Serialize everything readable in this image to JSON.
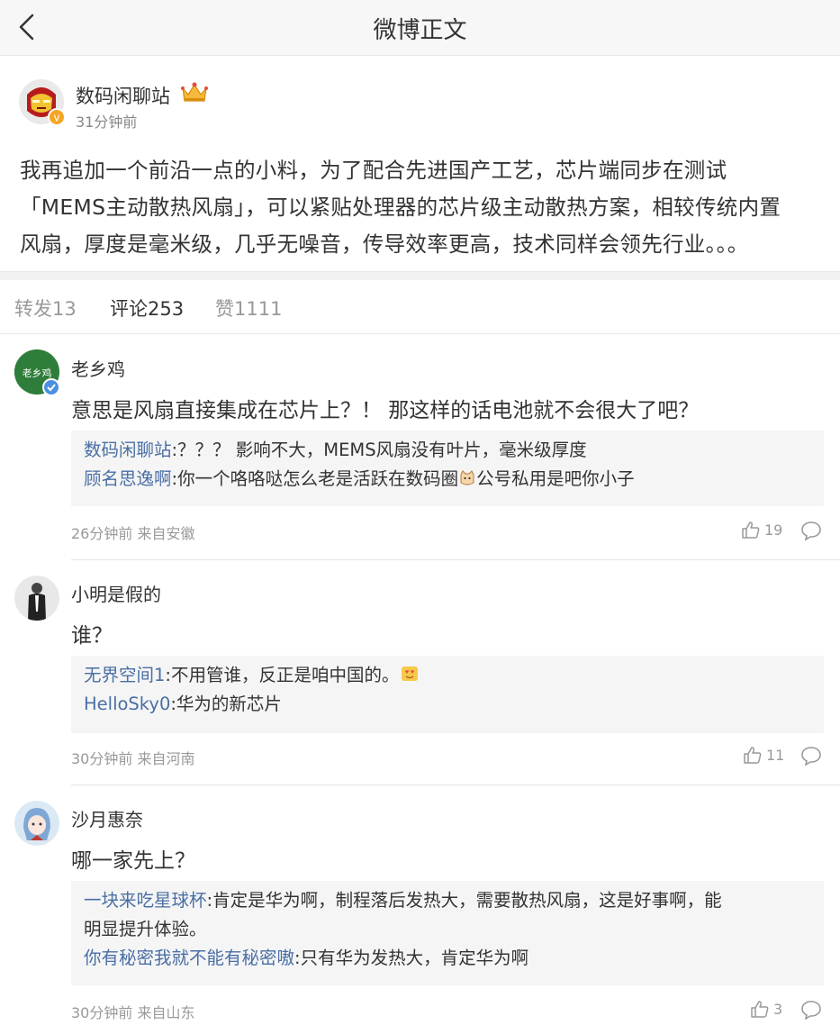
{
  "header": {
    "title": "微博正文"
  },
  "post": {
    "author": "数码闲聊站",
    "time": "31分钟前",
    "text_lines": [
      "我再追加一个前沿一点的小料，为了配合先进国产工艺，芯片端同步在测试",
      "「MEMS主动散热风扇」，可以紧贴处理器的芯片级主动散热方案，相较传统内置",
      "风扇，厚度是毫米级，几乎无噪音，传导效率更高，技术同样会领先行业。。。"
    ]
  },
  "tabs": {
    "repost": "转发13",
    "comments": "评论253",
    "likes": "赞1111"
  },
  "comments": [
    {
      "name": "老乡鸡",
      "avatar_text": "老乡鸡",
      "text": "意思是风扇直接集成在芯片上？！ 那这样的话电池就不会很大了吧？",
      "replies": [
        {
          "user": "数码闲聊站",
          "text": ":？？？ 影响不大，MEMS风扇没有叶片，毫米级厚度"
        },
        {
          "user": "顾名思逸啊",
          "text": ":你一个咯咯哒怎么老是活跃在数码圈",
          "text2": "公号私用是吧你小子"
        }
      ],
      "meta": "26分钟前 来自安徽",
      "likes": "19"
    },
    {
      "name": "小明是假的",
      "text": "谁？",
      "replies": [
        {
          "user": "无界空间1",
          "text": ":不用管谁，反正是咱中国的。"
        },
        {
          "user": "HelloSky0",
          "text": ":华为的新芯片"
        }
      ],
      "meta": "30分钟前 来自河南",
      "likes": "11"
    },
    {
      "name": "沙月惠奈",
      "text": "哪一家先上？",
      "replies": [
        {
          "user": "一块来吃星球杯",
          "text": ":肯定是华为啊，制程落后发热大，需要散热风扇，这是好事啊，能",
          "text2": "明显提升体验。"
        },
        {
          "user": "你有秘密我就不能有秘密嗷",
          "text": ":只有华为发热大，肯定华为啊"
        }
      ],
      "meta": "30分钟前 来自山东",
      "likes": "3"
    }
  ]
}
